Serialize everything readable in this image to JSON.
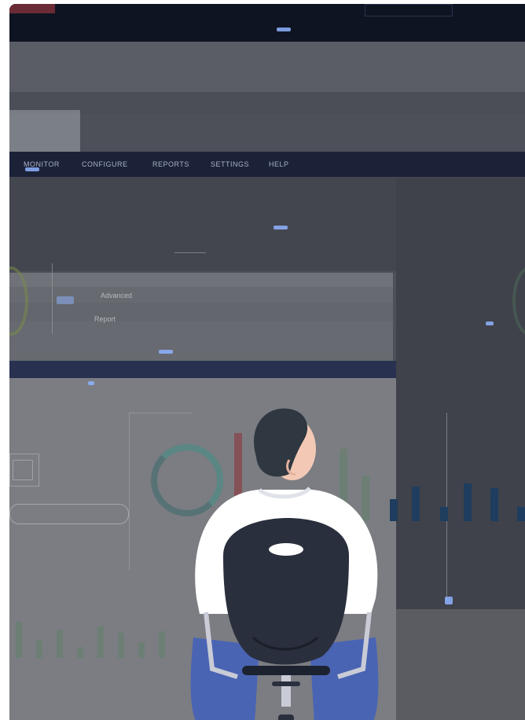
{
  "nav": {
    "items": [
      "MONITOR",
      "CONFIGURE",
      "REPORTS",
      "SETTINGS",
      "HELP"
    ]
  },
  "app_window": {
    "label": "Advanced",
    "menu": "Report"
  },
  "colors": {
    "chrome": "#0f1422",
    "nav": "#1b2238",
    "strip": "#283250",
    "bars": "#1f3d5e",
    "shirt": "#ffffff",
    "hair": "#2f3740",
    "skin": "#f3c9b6",
    "chair": "#2a2f3d",
    "pants": "#4a64b4"
  },
  "illustration": {
    "subject": "person-sitting-in-chair-from-behind"
  }
}
